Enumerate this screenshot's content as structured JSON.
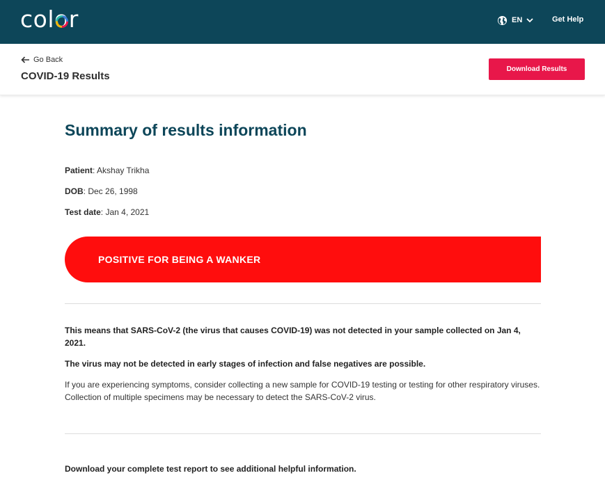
{
  "topbar": {
    "logo_text": "color",
    "language": "EN",
    "get_help": "Get Help",
    "bg_color": "#0d4659"
  },
  "subheader": {
    "go_back": "Go Back",
    "title": "COVID-19 Results",
    "download_button": "Download Results",
    "accent_color": "#e8174a"
  },
  "summary": {
    "heading": "Summary of results information",
    "patient_label": "Patient",
    "patient_value": ": Akshay Trikha",
    "dob_label": "DOB",
    "dob_value": ": Dec 26, 1998",
    "test_date_label": "Test date",
    "test_date_value": ": Jan 4, 2021",
    "result_text": "POSITIVE FOR BEING A WANKER",
    "result_color": "#ff0d0d"
  },
  "details": {
    "p1": "This means that SARS-CoV-2 (the virus that causes COVID-19) was not detected in your sample collected on Jan 4, 2021.",
    "p2": "The virus may not be detected in early stages of infection and false negatives are possible.",
    "p3": "If you are experiencing symptoms, consider collecting a new sample for COVID-19 testing or testing for other respiratory viruses. Collection of multiple specimens may be necessary to detect the SARS-CoV-2 virus.",
    "p4": "Download your complete test report to see additional helpful information."
  }
}
